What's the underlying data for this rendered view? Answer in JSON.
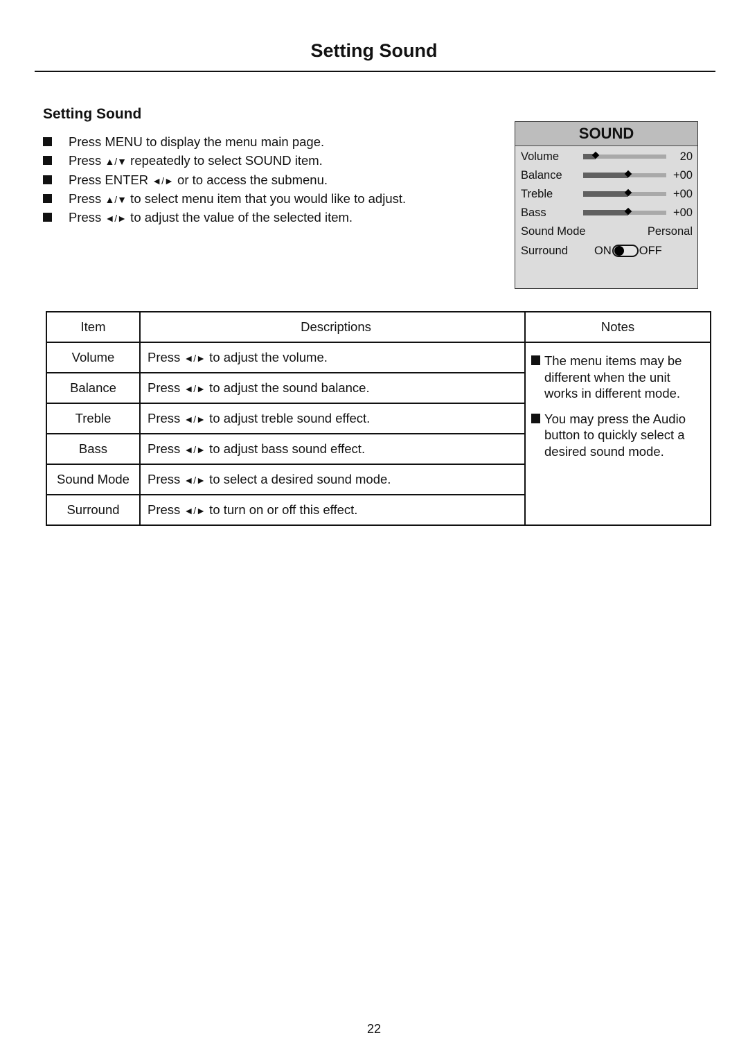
{
  "page": {
    "title": "Setting Sound",
    "section_heading": "Setting Sound",
    "page_number": "22"
  },
  "steps": [
    {
      "pre": "Press MENU to display the menu main page.",
      "keys": "",
      "post": ""
    },
    {
      "pre": "Press ",
      "keys": "▲/▼",
      "post": " repeatedly to select SOUND item."
    },
    {
      "pre": "Press ENTER ",
      "keys": "◄/►",
      "post": "  or to access the submenu."
    },
    {
      "pre": "Press ",
      "keys": "▲/▼",
      "post": "  to select menu item that you would like to adjust."
    },
    {
      "pre": "Press ",
      "keys": "◄/►",
      "post": " to adjust the value of the selected item."
    }
  ],
  "osd": {
    "header": "SOUND",
    "sliders": [
      {
        "label": "Volume",
        "value": "20",
        "fill_fraction": 0.15
      },
      {
        "label": "Balance",
        "value": "+00",
        "fill_fraction": 0.54
      },
      {
        "label": "Treble",
        "value": "+00",
        "fill_fraction": 0.54
      },
      {
        "label": "Bass",
        "value": "+00",
        "fill_fraction": 0.54
      }
    ],
    "sound_mode": {
      "label": "Sound Mode",
      "value": "Personal"
    },
    "surround": {
      "label": "Surround",
      "on_label": "ON",
      "off_label": "OFF",
      "state": "on"
    }
  },
  "table": {
    "headers": {
      "item": "Item",
      "descriptions": "Descriptions",
      "notes": "Notes"
    },
    "rows": [
      {
        "item": "Volume",
        "desc_pre": "Press ",
        "keys": "◄/►",
        "desc_post": " to adjust the volume."
      },
      {
        "item": "Balance",
        "desc_pre": "Press ",
        "keys": "◄/►",
        "desc_post": " to adjust the sound balance."
      },
      {
        "item": "Treble",
        "desc_pre": "Press ",
        "keys": "◄/►",
        "desc_post": " to adjust treble sound effect."
      },
      {
        "item": "Bass",
        "desc_pre": "Press ",
        "keys": "◄/►",
        "desc_post": " to adjust bass sound effect."
      },
      {
        "item": "Sound Mode",
        "desc_pre": "Press ",
        "keys": "◄/►",
        "desc_post": " to select a desired sound mode."
      },
      {
        "item": "Surround",
        "desc_pre": "Press ",
        "keys": "◄/►",
        "desc_post": " to turn on or off this effect."
      }
    ],
    "notes": [
      "The menu items may be different when the unit works in different mode.",
      "You may press the Audio button to quickly select a desired sound mode."
    ]
  }
}
